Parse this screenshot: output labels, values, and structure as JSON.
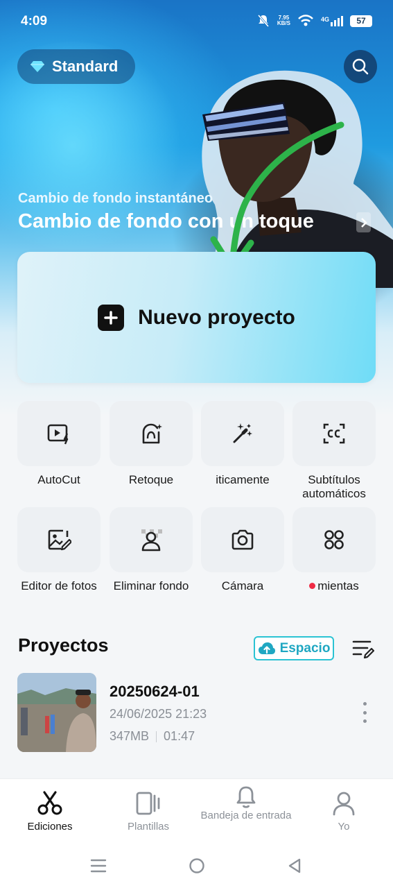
{
  "status_bar": {
    "time": "4:09",
    "net_speed_value": "7.95",
    "net_speed_unit": "KB/S",
    "signal_label": "4G",
    "battery": "57"
  },
  "header": {
    "plan_label": "Standard"
  },
  "banner": {
    "subtitle": "Cambio de fondo instantáneo",
    "title": "Cambio de fondo con un toque"
  },
  "new_project": {
    "label": "Nuevo proyecto"
  },
  "tools": [
    {
      "label": "AutoCut",
      "icon": "autocut-icon"
    },
    {
      "label": "Retoque",
      "icon": "retouch-icon"
    },
    {
      "label": "iticamente",
      "icon": "magic-wand-icon"
    },
    {
      "label": "Subtítulos automáticos",
      "icon": "captions-icon"
    },
    {
      "label": "Editor de fotos",
      "icon": "photo-edit-icon"
    },
    {
      "label": "Eliminar fondo",
      "icon": "remove-bg-icon"
    },
    {
      "label": "Cámara",
      "icon": "camera-icon"
    },
    {
      "label": "mientas",
      "icon": "grid-icon"
    }
  ],
  "projects": {
    "title": "Proyectos",
    "space_label": "Espacio",
    "items": [
      {
        "name": "20250624-01",
        "date": "24/06/2025 21:23",
        "size": "347MB",
        "duration": "01:47"
      }
    ]
  },
  "bottom_nav": [
    {
      "label": "Ediciones",
      "active": true
    },
    {
      "label": "Plantillas",
      "active": false
    },
    {
      "label": "Bandeja de entrada",
      "active": false
    },
    {
      "label": "Yo",
      "active": false
    }
  ],
  "colors": {
    "accent": "#1fa7c2",
    "annotation_arrow": "#2db34a",
    "notification_dot": "#ef2b45"
  }
}
